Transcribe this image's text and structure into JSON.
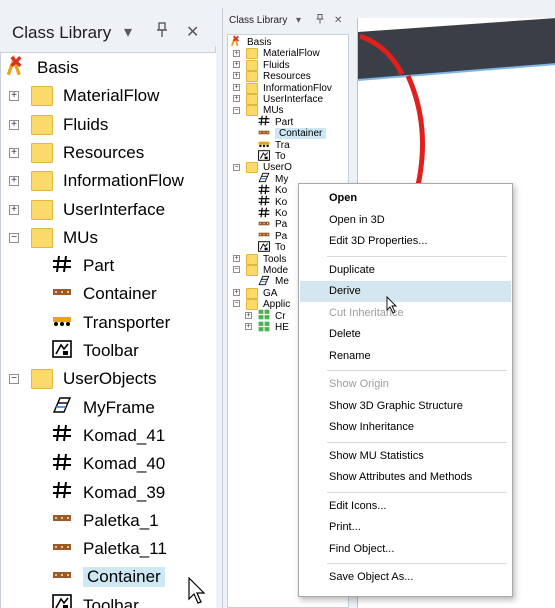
{
  "left_panel": {
    "title": "Class Library",
    "buttons": {
      "dropdown": "▾",
      "pin": "ᚌ",
      "close": "✕"
    },
    "root_label": "Basis",
    "items": [
      {
        "label": "MaterialFlow",
        "kind": "folder",
        "expander": "+"
      },
      {
        "label": "Fluids",
        "kind": "folder",
        "expander": "+"
      },
      {
        "label": "Resources",
        "kind": "folder",
        "expander": "+"
      },
      {
        "label": "InformationFlow",
        "kind": "folder",
        "expander": "+"
      },
      {
        "label": "UserInterface",
        "kind": "folder",
        "expander": "+"
      },
      {
        "label": "MUs",
        "kind": "folder",
        "expander": "−"
      },
      {
        "label": "Part",
        "kind": "part-icon"
      },
      {
        "label": "Container",
        "kind": "container-icon"
      },
      {
        "label": "Transporter",
        "kind": "transporter-icon"
      },
      {
        "label": "Toolbar",
        "kind": "toolbar-icon"
      },
      {
        "label": "UserObjects",
        "kind": "folder",
        "expander": "−"
      },
      {
        "label": "MyFrame",
        "kind": "frame-icon"
      },
      {
        "label": "Komad_41",
        "kind": "part-icon"
      },
      {
        "label": "Komad_40",
        "kind": "part-icon"
      },
      {
        "label": "Komad_39",
        "kind": "part-icon"
      },
      {
        "label": "Paletka_1",
        "kind": "container-icon"
      },
      {
        "label": "Paletka_11",
        "kind": "container-icon"
      },
      {
        "label": "Container",
        "kind": "container-icon",
        "selected": true
      },
      {
        "label": "Toolbar",
        "kind": "toolbar-icon"
      }
    ]
  },
  "small_panel": {
    "title": "Class Library",
    "buttons": {
      "dropdown": "▾",
      "pin": "ᚌ",
      "close": "✕"
    },
    "root_label": "Basis",
    "items": [
      {
        "label": "MaterialFlow",
        "kind": "folder",
        "expander": "+"
      },
      {
        "label": "Fluids",
        "kind": "folder",
        "expander": "+"
      },
      {
        "label": "Resources",
        "kind": "folder",
        "expander": "+"
      },
      {
        "label": "InformationFlov",
        "kind": "folder",
        "expander": "+"
      },
      {
        "label": "UserInterface",
        "kind": "folder",
        "expander": "+"
      },
      {
        "label": "MUs",
        "kind": "folder",
        "expander": "−"
      },
      {
        "label": "Part",
        "kind": "part-icon"
      },
      {
        "label": "Container",
        "kind": "container-icon",
        "selected": true
      },
      {
        "label": "Tra",
        "kind": "transporter-icon"
      },
      {
        "label": "To",
        "kind": "toolbar-icon"
      },
      {
        "label": "UserO",
        "kind": "folder",
        "expander": "−"
      },
      {
        "label": "My",
        "kind": "frame-icon"
      },
      {
        "label": "Ko",
        "kind": "part-icon"
      },
      {
        "label": "Ko",
        "kind": "part-icon"
      },
      {
        "label": "Ko",
        "kind": "part-icon"
      },
      {
        "label": "Pa",
        "kind": "container-icon"
      },
      {
        "label": "Pa",
        "kind": "container-icon"
      },
      {
        "label": "To",
        "kind": "toolbar-icon"
      },
      {
        "label": "Tools",
        "kind": "folder",
        "expander": "+"
      },
      {
        "label": "Mode",
        "kind": "folder",
        "expander": "−"
      },
      {
        "label": "Me",
        "kind": "frame-icon"
      },
      {
        "label": "GA",
        "kind": "folder",
        "expander": "+"
      },
      {
        "label": "Applic",
        "kind": "folder",
        "expander": "−"
      },
      {
        "label": "Cr",
        "kind": "library-icon",
        "expander": "+"
      },
      {
        "label": "HE",
        "kind": "library-icon",
        "expander": "+"
      }
    ]
  },
  "context_menu": {
    "items": [
      {
        "label": "Open",
        "bold": true
      },
      {
        "label": "Open in 3D"
      },
      {
        "label": "Edit 3D Properties..."
      },
      {
        "separator": true
      },
      {
        "label": "Duplicate"
      },
      {
        "label": "Derive",
        "hover": true
      },
      {
        "label": "Cut Inheritance",
        "disabled": true
      },
      {
        "label": "Delete"
      },
      {
        "label": "Rename"
      },
      {
        "separator": true
      },
      {
        "label": "Show Origin",
        "disabled": true
      },
      {
        "label": "Show 3D Graphic Structure"
      },
      {
        "label": "Show Inheritance"
      },
      {
        "separator": true
      },
      {
        "label": "Show MU Statistics"
      },
      {
        "label": "Show Attributes and Methods"
      },
      {
        "separator": true
      },
      {
        "label": "Edit Icons..."
      },
      {
        "label": "Print..."
      },
      {
        "label": "Find Object..."
      },
      {
        "separator": true
      },
      {
        "label": "Save Object As..."
      }
    ]
  },
  "colors": {
    "selection": "#cde8f3",
    "menu_hover": "#d4e6ef",
    "folder": "#fbd96a",
    "canvas_line": "#e0201d",
    "conveyor": "#3a3f47"
  }
}
